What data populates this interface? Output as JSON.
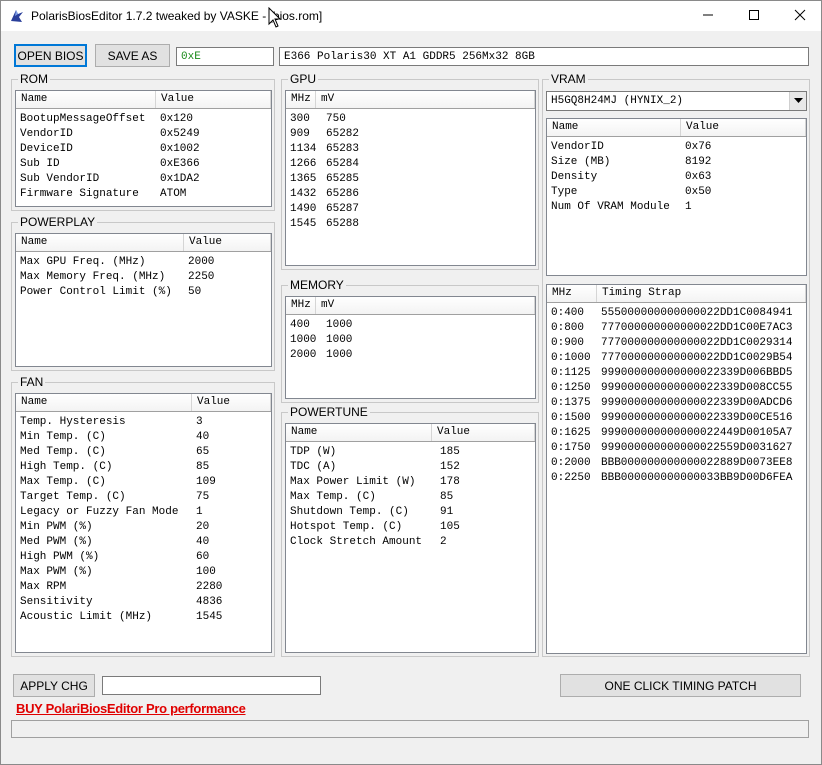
{
  "window": {
    "title": "PolarisBiosEditor 1.7.2 tweaked by VASKE - [bios.rom]",
    "icon": "polaris-app-icon"
  },
  "toolbar": {
    "open_label": "OPEN BIOS",
    "save_label": "SAVE AS",
    "hex_value": "0xE",
    "bios_name": "E366 Polaris30 XT A1 GDDR5 256Mx32 8GB"
  },
  "rom": {
    "label": "ROM",
    "headers": [
      "Name",
      "Value"
    ],
    "rows": [
      [
        "BootupMessageOffset",
        "0x120"
      ],
      [
        "VendorID",
        "0x5249"
      ],
      [
        "DeviceID",
        "0x1002"
      ],
      [
        "Sub ID",
        "0xE366"
      ],
      [
        "Sub VendorID",
        "0x1DA2"
      ],
      [
        "Firmware Signature",
        "ATOM"
      ]
    ]
  },
  "powerplay": {
    "label": "POWERPLAY",
    "headers": [
      "Name",
      "Value"
    ],
    "rows": [
      [
        "Max GPU Freq. (MHz)",
        "2000"
      ],
      [
        "Max Memory Freq. (MHz)",
        "2250"
      ],
      [
        "Power Control Limit (%)",
        "50"
      ]
    ]
  },
  "fan": {
    "label": "FAN",
    "headers": [
      "Name",
      "Value"
    ],
    "rows": [
      [
        "Temp. Hysteresis",
        "3"
      ],
      [
        "Min Temp. (C)",
        "40"
      ],
      [
        "Med Temp. (C)",
        "65"
      ],
      [
        "High Temp. (C)",
        "85"
      ],
      [
        "Max Temp. (C)",
        "109"
      ],
      [
        "Target Temp. (C)",
        "75"
      ],
      [
        "Legacy or Fuzzy Fan Mode",
        "1"
      ],
      [
        "Min PWM (%)",
        "20"
      ],
      [
        "Med PWM (%)",
        "40"
      ],
      [
        "High PWM (%)",
        "60"
      ],
      [
        "Max PWM (%)",
        "100"
      ],
      [
        "Max RPM",
        "2280"
      ],
      [
        "Sensitivity",
        "4836"
      ],
      [
        "Acoustic Limit (MHz)",
        "1545"
      ]
    ]
  },
  "gpu": {
    "label": "GPU",
    "headers": [
      "MHz",
      "mV"
    ],
    "rows": [
      [
        "300",
        "750"
      ],
      [
        "909",
        "65282"
      ],
      [
        "1134",
        "65283"
      ],
      [
        "1266",
        "65284"
      ],
      [
        "1365",
        "65285"
      ],
      [
        "1432",
        "65286"
      ],
      [
        "1490",
        "65287"
      ],
      [
        "1545",
        "65288"
      ]
    ]
  },
  "memory": {
    "label": "MEMORY",
    "headers": [
      "MHz",
      "mV"
    ],
    "rows": [
      [
        "400",
        "1000"
      ],
      [
        "1000",
        "1000"
      ],
      [
        "2000",
        "1000"
      ]
    ]
  },
  "powertune": {
    "label": "POWERTUNE",
    "headers": [
      "Name",
      "Value"
    ],
    "rows": [
      [
        "TDP (W)",
        "185"
      ],
      [
        "TDC (A)",
        "152"
      ],
      [
        "Max Power Limit (W)",
        "178"
      ],
      [
        "Max Temp. (C)",
        "85"
      ],
      [
        "Shutdown Temp. (C)",
        "91"
      ],
      [
        "Hotspot Temp. (C)",
        "105"
      ],
      [
        "Clock Stretch Amount",
        "2"
      ]
    ]
  },
  "vram": {
    "label": "VRAM",
    "selected": "H5GQ8H24MJ (HYNIX_2)",
    "headers": [
      "Name",
      "Value"
    ],
    "rows": [
      [
        "VendorID",
        "0x76"
      ],
      [
        "Size (MB)",
        "8192"
      ],
      [
        "Density",
        "0x63"
      ],
      [
        "Type",
        "0x50"
      ],
      [
        "Num Of VRAM Module",
        "1"
      ]
    ],
    "timing_headers": [
      "MHz",
      "Timing Strap"
    ],
    "timing_rows": [
      [
        "0:400",
        "555000000000000022DD1C0084941"
      ],
      [
        "0:800",
        "777000000000000022DD1C00E7AC3"
      ],
      [
        "0:900",
        "777000000000000022DD1C0029314"
      ],
      [
        "0:1000",
        "777000000000000022DD1C0029B54"
      ],
      [
        "0:1125",
        "999000000000000022339D006BBD5"
      ],
      [
        "0:1250",
        "999000000000000022339D008CC55"
      ],
      [
        "0:1375",
        "999000000000000022339D00ADCD6"
      ],
      [
        "0:1500",
        "999000000000000022339D00CE516"
      ],
      [
        "0:1625",
        "999000000000000022449D00105A7"
      ],
      [
        "0:1750",
        "999000000000000022559D0031627"
      ],
      [
        "0:2000",
        "BBB000000000000022889D0073EE8"
      ],
      [
        "0:2250",
        "BBB000000000000033BB9D00D6FEA"
      ]
    ]
  },
  "bottom": {
    "apply_label": "APPLY CHG",
    "apply_field": "",
    "timing_patch_label": "ONE CLICK TIMING PATCH",
    "promo_text": "BUY PolariBiosEditor Pro performance",
    "status_text": ""
  }
}
